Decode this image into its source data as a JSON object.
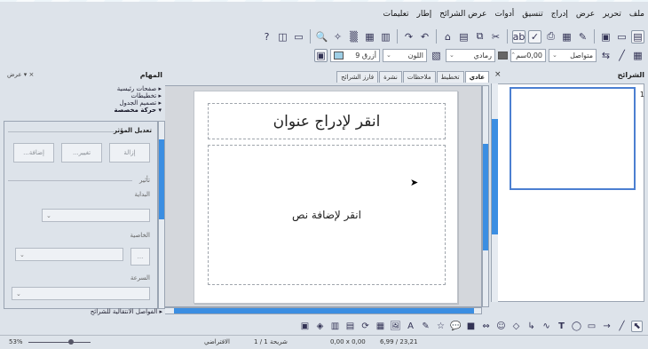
{
  "menu": [
    "ملف",
    "تحرير",
    "عرض",
    "إدراج",
    "تنسيق",
    "أدوات",
    "عرض الشرائح",
    "إطار",
    "تعليمات"
  ],
  "toolbar2": {
    "color_name": "أزرق 9",
    "area_style": "رمادي",
    "line_style": "متواصل",
    "line_width": "0,00سم"
  },
  "slides_pane": {
    "title": "الشرائح",
    "close": "×",
    "slide_number": "1"
  },
  "tabs": [
    "عادي",
    "تخطيط",
    "ملاحظات",
    "نشرة",
    "فارز الشرائح"
  ],
  "slide": {
    "title_placeholder": "انقر لإدراج عنوان",
    "body_placeholder": "انقر لإضافة نص"
  },
  "tasks_pane": {
    "title": "المهام",
    "view_label": "عرض",
    "sections": [
      "صفحات رئيسية",
      "تخطيطات",
      "تصميم الجدول",
      "حركة مخصصة"
    ],
    "modify_effect": "تعديل المؤثر",
    "add_button": "إضافة...",
    "change_button": "تغيير...",
    "remove_button": "إزالة",
    "effect_group": "تأثير",
    "start_label": "البداية",
    "property_label": "الخاصية",
    "speed_label": "السرعة",
    "more_button": "...",
    "footer": "الفواصل الانتقالية للشرائح"
  },
  "status": {
    "position": "6,99 / 23,21",
    "size": "0,00 x 0,00",
    "slide": "شريحة 1 / 1",
    "layout": "الافتراضي",
    "zoom": "53%"
  },
  "icons": {
    "selection": "cursor-icon",
    "line": "line-icon",
    "arrow": "arrow-icon",
    "rect": "rectangle-icon",
    "ellipse": "ellipse-icon",
    "text": "text-icon"
  },
  "colors": {
    "accent": "#3b8ee2",
    "panel_bg": "#dde3ea"
  }
}
